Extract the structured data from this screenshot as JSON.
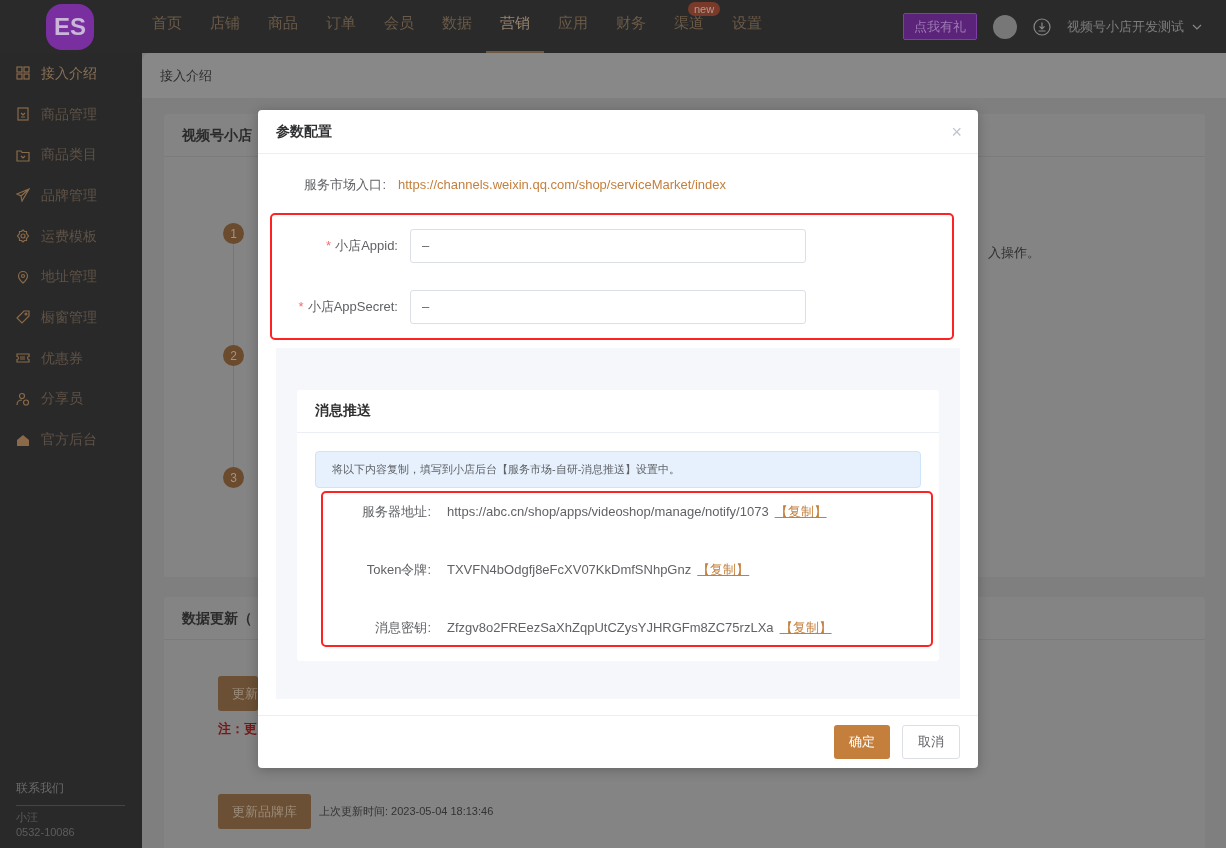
{
  "top_nav": {
    "logo": "ES",
    "items": [
      {
        "label": "首页",
        "selected": false
      },
      {
        "label": "店铺",
        "selected": false
      },
      {
        "label": "商品",
        "selected": false
      },
      {
        "label": "订单",
        "selected": false
      },
      {
        "label": "会员",
        "selected": false
      },
      {
        "label": "数据",
        "selected": false
      },
      {
        "label": "营销",
        "selected": true
      },
      {
        "label": "应用",
        "selected": false
      },
      {
        "label": "财务",
        "selected": false
      },
      {
        "label": "渠道",
        "selected": false,
        "badge": "new"
      },
      {
        "label": "设置",
        "selected": false
      }
    ],
    "gift_button": "点我有礼",
    "account": "视频号小店开发测试"
  },
  "sidebar": {
    "items": [
      {
        "label": "接入介绍",
        "selected": true
      },
      {
        "label": "商品管理",
        "selected": false
      },
      {
        "label": "商品类目",
        "selected": false
      },
      {
        "label": "品牌管理",
        "selected": false
      },
      {
        "label": "运费模板",
        "selected": false
      },
      {
        "label": "地址管理",
        "selected": false
      },
      {
        "label": "橱窗管理",
        "selected": false
      },
      {
        "label": "优惠券",
        "selected": false
      },
      {
        "label": "分享员",
        "selected": false
      },
      {
        "label": "官方后台",
        "selected": false
      }
    ],
    "contact_title": "联系我们",
    "contact_name": "小汪",
    "contact_phone": "0532-10086"
  },
  "breadcrumb": "接入介绍",
  "background": {
    "card1_title": "视频号小店",
    "steps": [
      "1",
      "2",
      "3"
    ],
    "step_text_fragment": "入操作。",
    "card2_title": "数据更新（",
    "update_button_fragment": "更新",
    "note_fragment": "注：更",
    "brand_button": "更新品牌库",
    "last_update": "上次更新时间: 2023-05-04 18:13:46"
  },
  "dialog": {
    "title": "参数配置",
    "close": "×",
    "market_label": "服务市场入口:",
    "market_link": "https://channels.weixin.qq.com/shop/serviceMarket/index",
    "fields": [
      {
        "required_mark": "*",
        "label": "小店Appid:",
        "value": "–"
      },
      {
        "required_mark": "*",
        "label": "小店AppSecret:",
        "value": "–"
      }
    ],
    "push": {
      "title": "消息推送",
      "notice": "将以下内容复制，填写到小店后台【服务市场-自研-消息推送】设置中。",
      "rows": [
        {
          "label": "服务器地址:",
          "value": "https://abc.cn/shop/apps/videoshop/manage/notify/1073",
          "action": "【复制】"
        },
        {
          "label": "Token令牌:",
          "value": "TXVFN4bOdgfj8eFcXV07KkDmfSNhpGnz",
          "action": "【复制】"
        },
        {
          "label": "消息密钥:",
          "value": "Zfzgv8o2FREezSaXhZqpUtCZysYJHRGFm8ZC75rzLXa",
          "action": "【复制】"
        }
      ]
    },
    "confirm": "确定",
    "cancel": "取消"
  }
}
